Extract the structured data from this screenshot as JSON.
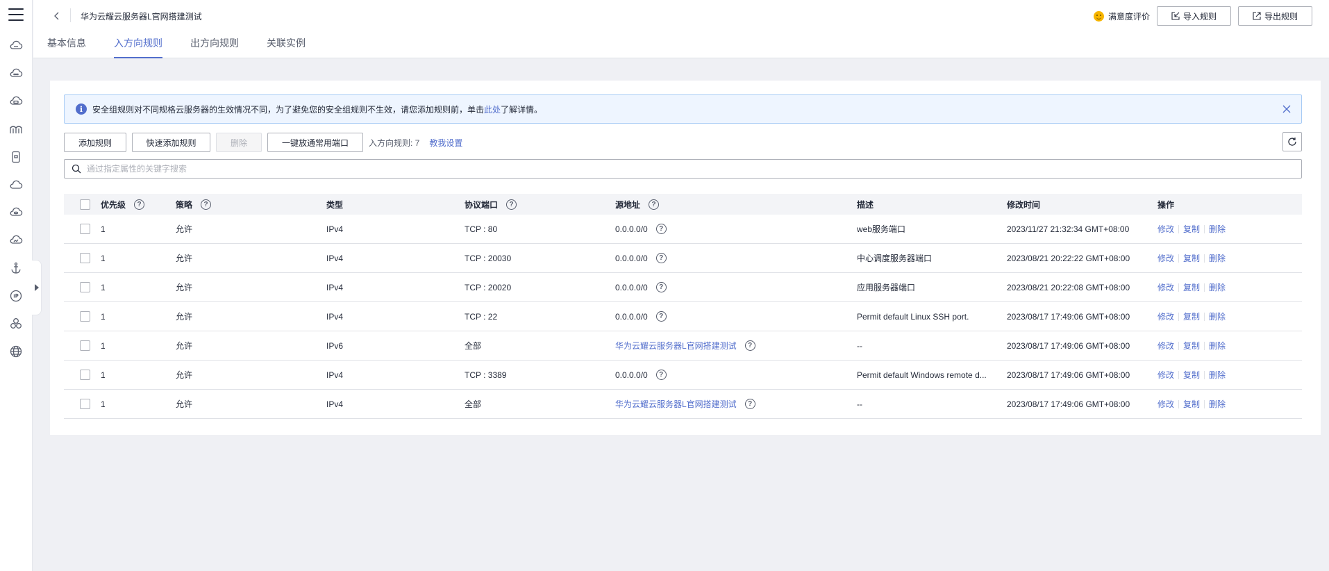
{
  "header": {
    "title": "华为云耀云服务器L官网搭建测试",
    "tabs": [
      {
        "label": "基本信息",
        "active": false
      },
      {
        "label": "入方向规则",
        "active": true
      },
      {
        "label": "出方向规则",
        "active": false
      },
      {
        "label": "关联实例",
        "active": false
      }
    ],
    "satisfaction": "满意度评价",
    "import_label": "导入规则",
    "export_label": "导出规则"
  },
  "notice": {
    "text_before": "安全组规则对不同规格云服务器的生效情况不同，为了避免您的安全组规则不生效，请您添加规则前，单击",
    "link": "此处",
    "text_after": "了解详情。"
  },
  "toolbar": {
    "add": "添加规则",
    "quick_add": "快速添加规则",
    "delete": "删除",
    "open_common": "一键放通常用端口",
    "count": "入方向规则: 7",
    "teach": "教我设置"
  },
  "search": {
    "placeholder": "通过指定属性的关键字搜索"
  },
  "table": {
    "columns": {
      "priority": "优先级",
      "policy": "策略",
      "type": "类型",
      "port": "协议端口",
      "source": "源地址",
      "desc": "描述",
      "time": "修改时间",
      "ops": "操作"
    },
    "op_labels": {
      "edit": "修改",
      "copy": "复制",
      "delete": "删除"
    },
    "rows": [
      {
        "priority": "1",
        "policy": "允许",
        "type": "IPv4",
        "port": "TCP : 80",
        "source": "0.0.0.0/0",
        "source_link": false,
        "desc": "web服务端口",
        "time": "2023/11/27 21:32:34 GMT+08:00"
      },
      {
        "priority": "1",
        "policy": "允许",
        "type": "IPv4",
        "port": "TCP : 20030",
        "source": "0.0.0.0/0",
        "source_link": false,
        "desc": "中心调度服务器端口",
        "time": "2023/08/21 20:22:22 GMT+08:00"
      },
      {
        "priority": "1",
        "policy": "允许",
        "type": "IPv4",
        "port": "TCP : 20020",
        "source": "0.0.0.0/0",
        "source_link": false,
        "desc": "应用服务器端口",
        "time": "2023/08/21 20:22:08 GMT+08:00"
      },
      {
        "priority": "1",
        "policy": "允许",
        "type": "IPv4",
        "port": "TCP : 22",
        "source": "0.0.0.0/0",
        "source_link": false,
        "desc": "Permit default Linux SSH port.",
        "time": "2023/08/17 17:49:06 GMT+08:00"
      },
      {
        "priority": "1",
        "policy": "允许",
        "type": "IPv6",
        "port": "全部",
        "source": "华为云耀云服务器L官网搭建测试",
        "source_link": true,
        "desc": "--",
        "time": "2023/08/17 17:49:06 GMT+08:00"
      },
      {
        "priority": "1",
        "policy": "允许",
        "type": "IPv4",
        "port": "TCP : 3389",
        "source": "0.0.0.0/0",
        "source_link": false,
        "desc": "Permit default Windows remote d...",
        "time": "2023/08/17 17:49:06 GMT+08:00"
      },
      {
        "priority": "1",
        "policy": "允许",
        "type": "IPv4",
        "port": "全部",
        "source": "华为云耀云服务器L官网搭建测试",
        "source_link": true,
        "desc": "--",
        "time": "2023/08/17 17:49:06 GMT+08:00"
      }
    ]
  },
  "rail_icons": [
    "cloud-server-icon",
    "cloud-more-icon",
    "cloud-web-icon",
    "bridge-icon",
    "device-icon",
    "cloud-icon",
    "cloud-database-icon",
    "cloud-monitor-icon",
    "anchor-icon",
    "ip-icon",
    "cluster-icon",
    "globe-icon"
  ],
  "colors": {
    "accent": "#526ecc",
    "text": "#252b3a",
    "notice_bg": "#eef5ff",
    "notice_border": "#a8cbf5"
  }
}
